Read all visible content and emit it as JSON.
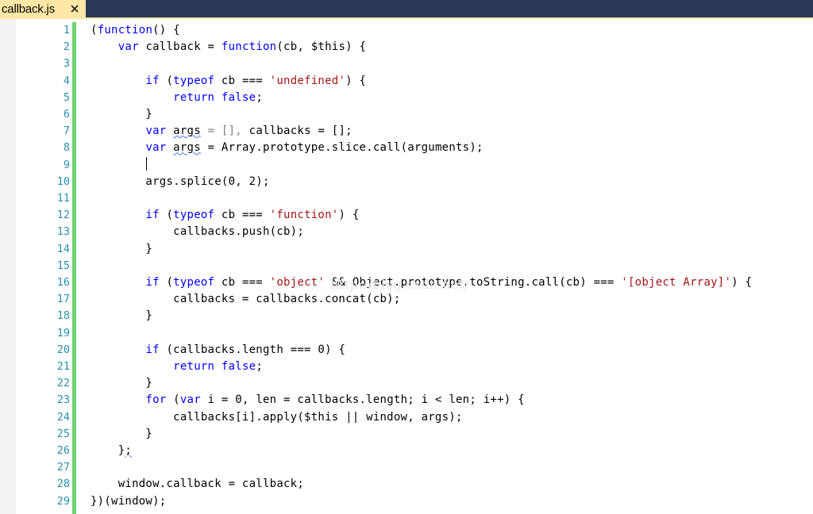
{
  "tab": {
    "filename": "callback.js",
    "close_icon": "close-icon"
  },
  "colors": {
    "tabstrip": "#293955",
    "active_tab": "#ffe8a6",
    "keyword": "#0000ff",
    "string": "#a31515",
    "line_number": "#2b91af",
    "change_bar": "#6ed36e"
  },
  "editor": {
    "lines": [
      {
        "number": "1",
        "tokens": [
          {
            "t": "(",
            "c": "p"
          },
          {
            "t": "function",
            "c": "kw"
          },
          {
            "t": "() {",
            "c": "p"
          }
        ]
      },
      {
        "number": "2",
        "tokens": [
          {
            "t": "    ",
            "c": "p"
          },
          {
            "t": "var",
            "c": "kw"
          },
          {
            "t": " callback = ",
            "c": "p"
          },
          {
            "t": "function",
            "c": "kw"
          },
          {
            "t": "(cb, $this) {",
            "c": "p"
          }
        ]
      },
      {
        "number": "3",
        "tokens": []
      },
      {
        "number": "4",
        "tokens": [
          {
            "t": "        ",
            "c": "p"
          },
          {
            "t": "if",
            "c": "kw"
          },
          {
            "t": " (",
            "c": "p"
          },
          {
            "t": "typeof",
            "c": "kw"
          },
          {
            "t": " cb === ",
            "c": "p"
          },
          {
            "t": "'undefined'",
            "c": "str"
          },
          {
            "t": ") {",
            "c": "p"
          }
        ]
      },
      {
        "number": "5",
        "tokens": [
          {
            "t": "            ",
            "c": "p"
          },
          {
            "t": "return",
            "c": "kw"
          },
          {
            "t": " ",
            "c": "p"
          },
          {
            "t": "false",
            "c": "kw"
          },
          {
            "t": ";",
            "c": "p"
          }
        ]
      },
      {
        "number": "6",
        "tokens": [
          {
            "t": "        }",
            "c": "p"
          }
        ]
      },
      {
        "number": "7",
        "tokens": [
          {
            "t": "        ",
            "c": "p"
          },
          {
            "t": "var",
            "c": "kw"
          },
          {
            "t": " ",
            "c": "p"
          },
          {
            "t": "args",
            "c": "sq"
          },
          {
            "t": " = [], ",
            "c": "lt"
          },
          {
            "t": "callbacks = [];",
            "c": "p"
          }
        ]
      },
      {
        "number": "8",
        "tokens": [
          {
            "t": "        ",
            "c": "p"
          },
          {
            "t": "var",
            "c": "kw"
          },
          {
            "t": " ",
            "c": "p"
          },
          {
            "t": "args",
            "c": "sq"
          },
          {
            "t": " = Array.prototype.slice.call(arguments);",
            "c": "p"
          }
        ]
      },
      {
        "number": "9",
        "tokens": []
      },
      {
        "number": "10",
        "tokens": [
          {
            "t": "        args.splice(0, 2);",
            "c": "p"
          }
        ]
      },
      {
        "number": "11",
        "tokens": []
      },
      {
        "number": "12",
        "tokens": [
          {
            "t": "        ",
            "c": "p"
          },
          {
            "t": "if",
            "c": "kw"
          },
          {
            "t": " (",
            "c": "p"
          },
          {
            "t": "typeof",
            "c": "kw"
          },
          {
            "t": " cb === ",
            "c": "p"
          },
          {
            "t": "'function'",
            "c": "str"
          },
          {
            "t": ") {",
            "c": "p"
          }
        ]
      },
      {
        "number": "13",
        "tokens": [
          {
            "t": "            callbacks.push(cb);",
            "c": "p"
          }
        ]
      },
      {
        "number": "14",
        "tokens": [
          {
            "t": "        }",
            "c": "p"
          }
        ]
      },
      {
        "number": "15",
        "tokens": []
      },
      {
        "number": "16",
        "tokens": [
          {
            "t": "        ",
            "c": "p"
          },
          {
            "t": "if",
            "c": "kw"
          },
          {
            "t": " (",
            "c": "p"
          },
          {
            "t": "typeof",
            "c": "kw"
          },
          {
            "t": " cb === ",
            "c": "p"
          },
          {
            "t": "'object'",
            "c": "str"
          },
          {
            "t": " && Object.prototype.toString.call(cb) === ",
            "c": "p"
          },
          {
            "t": "'[object Array]'",
            "c": "str"
          },
          {
            "t": ") {",
            "c": "p"
          }
        ]
      },
      {
        "number": "17",
        "tokens": [
          {
            "t": "            callbacks = callbacks.concat(cb);",
            "c": "p"
          }
        ]
      },
      {
        "number": "18",
        "tokens": [
          {
            "t": "        }",
            "c": "p"
          }
        ]
      },
      {
        "number": "19",
        "tokens": []
      },
      {
        "number": "20",
        "tokens": [
          {
            "t": "        ",
            "c": "p"
          },
          {
            "t": "if",
            "c": "kw"
          },
          {
            "t": " (callbacks.length === 0) {",
            "c": "p"
          }
        ]
      },
      {
        "number": "21",
        "tokens": [
          {
            "t": "            ",
            "c": "p"
          },
          {
            "t": "return",
            "c": "kw"
          },
          {
            "t": " ",
            "c": "p"
          },
          {
            "t": "false",
            "c": "kw"
          },
          {
            "t": ";",
            "c": "p"
          }
        ]
      },
      {
        "number": "22",
        "tokens": [
          {
            "t": "        }",
            "c": "p"
          }
        ]
      },
      {
        "number": "23",
        "tokens": [
          {
            "t": "        ",
            "c": "p"
          },
          {
            "t": "for",
            "c": "kw"
          },
          {
            "t": " (",
            "c": "p"
          },
          {
            "t": "var",
            "c": "kw"
          },
          {
            "t": " i = 0, len = callbacks.length; i < len; i++) {",
            "c": "p"
          }
        ]
      },
      {
        "number": "24",
        "tokens": [
          {
            "t": "            callbacks[i].apply($this || window, args);",
            "c": "p"
          }
        ]
      },
      {
        "number": "25",
        "tokens": [
          {
            "t": "        }",
            "c": "p"
          }
        ]
      },
      {
        "number": "26",
        "tokens": [
          {
            "t": "    }",
            "c": "p"
          },
          {
            "t": ";",
            "c": "sq"
          }
        ]
      },
      {
        "number": "27",
        "tokens": []
      },
      {
        "number": "28",
        "tokens": [
          {
            "t": "    window.callback = callback;",
            "c": "p"
          }
        ]
      },
      {
        "number": "29",
        "tokens": [
          {
            "t": "})(window);",
            "c": "p"
          }
        ]
      }
    ]
  },
  "watermark": "http://blog.csdn.net/"
}
